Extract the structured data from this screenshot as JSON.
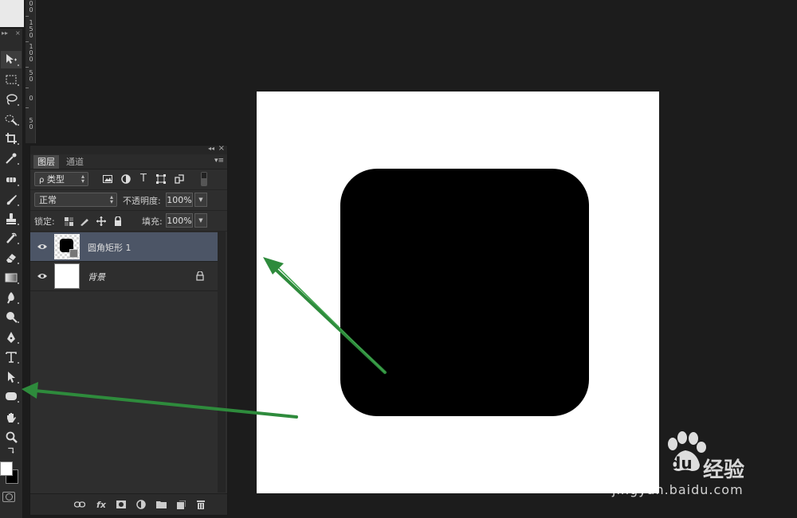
{
  "ruler": {
    "groups": [
      {
        "digits": [
          "0",
          "0"
        ]
      },
      {
        "digits": [
          "1",
          "5",
          "0"
        ]
      },
      {
        "digits": [
          "1",
          "0",
          "0"
        ]
      },
      {
        "digits": [
          "5",
          "0"
        ]
      },
      {
        "digits": [
          "0"
        ]
      },
      {
        "digits": [
          "5",
          "0"
        ]
      }
    ]
  },
  "toolbox": {
    "header_glyph": "▸▸",
    "header_close": "×"
  },
  "layers_panel": {
    "collapse_glyph": "◂◂",
    "close_glyph": "×",
    "menu_glyph": "▾≡",
    "tabs": [
      {
        "label": "图层",
        "selected": true
      },
      {
        "label": "通道",
        "selected": false
      }
    ],
    "filter": {
      "search_glyph": "ρ",
      "kind_label": "类型",
      "icon_names": [
        "image-filter-icon",
        "adjustment-filter-icon",
        "type-filter-icon",
        "shape-filter-icon",
        "smart-object-filter-icon"
      ],
      "type_glyph": "T"
    },
    "blend_mode": "正常",
    "opacity_label": "不透明度:",
    "opacity_value": "100%",
    "lock_label": "锁定:",
    "fill_label": "填充:",
    "fill_value": "100%",
    "layers": [
      {
        "name": "圆角矩形 1",
        "selected": true,
        "italic": false,
        "locked": false,
        "visible": true
      },
      {
        "name": "背景",
        "selected": false,
        "italic": true,
        "locked": true,
        "visible": true
      }
    ],
    "bottom_icons": [
      "link-layers-icon",
      "fx-icon",
      "layer-mask-icon",
      "adjustment-layer-icon",
      "new-group-icon",
      "new-layer-icon",
      "delete-layer-icon"
    ],
    "fx_label": "fx"
  },
  "canvas": {
    "background_color": "#ffffff",
    "shape_color": "#000000"
  },
  "colors": {
    "foreground": "#ffffff",
    "background": "#000000",
    "arrow": "#2e8b3c",
    "selection": "#4c5566"
  },
  "watermark": {
    "brand_latin": "Bai",
    "brand_du": "du",
    "brand_cn": "经验",
    "url": "jingyan.baidu.com"
  }
}
